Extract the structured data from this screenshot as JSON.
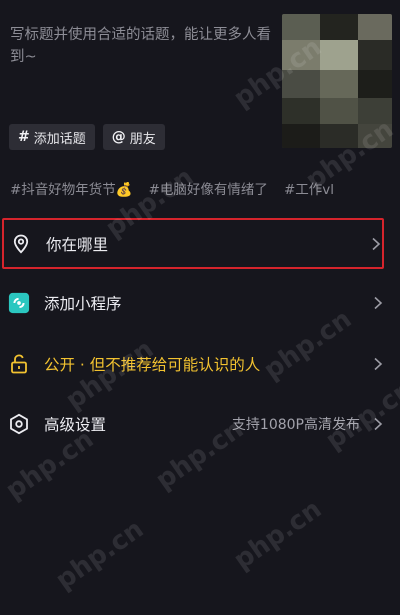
{
  "caption": {
    "placeholder": "写标题并使用合适的话题，能让更多人看到~"
  },
  "chips": [
    {
      "symbol": "#",
      "label": "添加话题",
      "icon": "hashtag-icon"
    },
    {
      "symbol": "@",
      "label": "朋友",
      "icon": "at-icon"
    }
  ],
  "topics": [
    "#抖音好物年货节💰",
    "#电脑好像有情绪了",
    "#工作vl"
  ],
  "rows": [
    {
      "label": "你在哪里",
      "value": "",
      "icon": "location-pin-icon"
    },
    {
      "label": "添加小程序",
      "value": "",
      "icon": "mini-program-icon"
    },
    {
      "label": "公开 · 但不推荐给可能认识的人",
      "value": "",
      "icon": "unlock-icon"
    },
    {
      "label": "高级设置",
      "value": "支持1080P高清发布",
      "icon": "settings-icon"
    }
  ],
  "watermark": "php.cn",
  "colors": {
    "background": "#16161d",
    "accent_yellow": "#f2c230",
    "highlight_red": "#d6242c",
    "mini_program_teal": "#2bc7c0"
  }
}
